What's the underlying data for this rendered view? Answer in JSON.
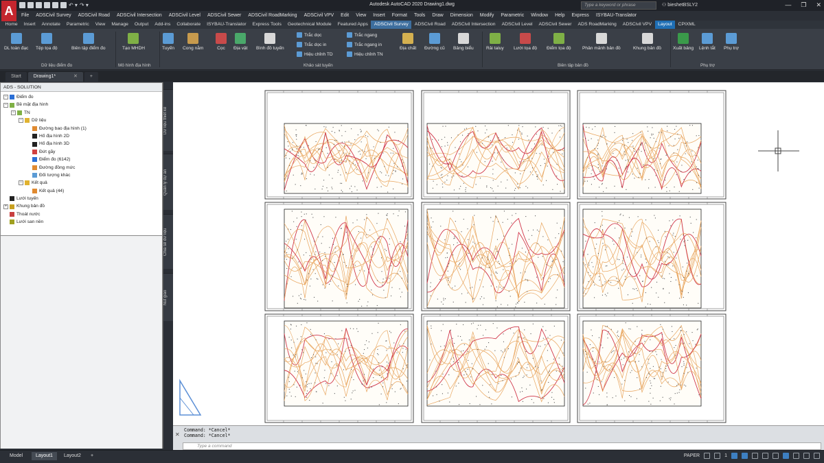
{
  "app": {
    "title": "Autodesk AutoCAD 2020    Drawing1.dwg",
    "logo": "A",
    "search_placeholder": "Type a keyword or phrase",
    "user": "bieshetBSLY2"
  },
  "menu": [
    "File",
    "ADSCivil Survey",
    "ADSCivil Road",
    "ADSCivil Intersection",
    "ADSCivil Level",
    "ADSCivil Sewer",
    "ADSCivil RoadMarking",
    "ADSCivil VPV",
    "Edit",
    "View",
    "Insert",
    "Format",
    "Tools",
    "Draw",
    "Dimension",
    "Modify",
    "Parametric",
    "Window",
    "Help",
    "Express",
    "ISYBAU-Translator"
  ],
  "ribbon_tabs": [
    "Home",
    "Insert",
    "Annotate",
    "Parametric",
    "View",
    "Manage",
    "Output",
    "Add-ins",
    "Collaborate",
    "ISYBAU-Translator",
    "Express Tools",
    "Geotechnical Module",
    "Featured Apps",
    "ADSCivil Survey",
    "ADSCivil Road",
    "ADSCivil Intersection",
    "ADSCivil Level",
    "ADSCivil Sewer",
    "ADS RoadMarking",
    "ADSCivil VPV",
    "Layout",
    "CPIXML"
  ],
  "ribbon": {
    "tools": [
      "DL toàn đạc",
      "Tệp tọa độ",
      "Biên tập điểm đo",
      "Tạo MHDH",
      "Tuyến",
      "Cong nằm",
      "Cọc",
      "Địa vật",
      "Bình đồ tuyến",
      "Địa chất",
      "Đường cũ",
      "Bảng biểu",
      "Rải taluy",
      "Lưới tọa độ",
      "Điểm tọa độ",
      "Phân mảnh bản đồ",
      "Khung bản đồ",
      "Xuất bảng",
      "Lệnh tắt",
      "Phụ trợ"
    ],
    "small": [
      "Trắc dọc",
      "Trắc dọc in",
      "Hiệu chỉnh TD",
      "Trắc ngang",
      "Trắc ngang in",
      "Hiệu chỉnh TN"
    ],
    "groups": [
      "Dữ liệu điểm đo",
      "Mô hình địa hình",
      "Khảo sát tuyến",
      "Biên tập bản đồ",
      "Phụ trợ"
    ]
  },
  "file_tabs": {
    "start": "Start",
    "drawing": "Drawing1*",
    "close": "✕",
    "add": "+"
  },
  "palette": {
    "title": "ADS - SOLUTION",
    "tree": [
      {
        "label": "Điểm đo",
        "indent": 0,
        "toggle": "−",
        "color": "#2b6fd6"
      },
      {
        "label": "Bề mặt địa hình",
        "indent": 0,
        "toggle": "−",
        "color": "#7fb046"
      },
      {
        "label": "TN",
        "indent": 1,
        "toggle": "−",
        "color": "#7fb046"
      },
      {
        "label": "Dữ liệu",
        "indent": 2,
        "toggle": "−",
        "color": "#e0b230"
      },
      {
        "label": "Đường bao địa hình (1)",
        "indent": 3,
        "toggle": "",
        "color": "#e08a30"
      },
      {
        "label": "Hố địa hình 2D",
        "indent": 3,
        "toggle": "",
        "color": "#222222"
      },
      {
        "label": "Hố địa hình 3D",
        "indent": 3,
        "toggle": "",
        "color": "#222222"
      },
      {
        "label": "Đứt gãy",
        "indent": 3,
        "toggle": "",
        "color": "#d04040"
      },
      {
        "label": "Điểm đo (6142)",
        "indent": 3,
        "toggle": "",
        "color": "#2b6fd6"
      },
      {
        "label": "Đường đồng mức",
        "indent": 3,
        "toggle": "",
        "color": "#e08a30"
      },
      {
        "label": "Đối tượng khác",
        "indent": 3,
        "toggle": "",
        "color": "#5b9bd5"
      },
      {
        "label": "Kết quả",
        "indent": 2,
        "toggle": "−",
        "color": "#e0b230"
      },
      {
        "label": "Kết quả (44)",
        "indent": 3,
        "toggle": "",
        "color": "#e08a30"
      },
      {
        "label": "Lưới tuyến",
        "indent": 0,
        "toggle": "",
        "color": "#222222"
      },
      {
        "label": "Khung bản đồ",
        "indent": 0,
        "toggle": "+",
        "color": "#c8a020"
      },
      {
        "label": "Thoát nước",
        "indent": 0,
        "toggle": "",
        "color": "#c84040"
      },
      {
        "label": "Lưới san nền",
        "indent": 0,
        "toggle": "",
        "color": "#a0a020"
      }
    ]
  },
  "vertical_tabs": [
    "Dữ liệu thiết kế",
    "Quản lý dự án",
    "Chia sẻ dữ liệu",
    "Nút giao"
  ],
  "command": {
    "history": [
      "Command: *Cancel*",
      "Command: *Cancel*"
    ],
    "placeholder": "Type a command",
    "close": "✕"
  },
  "layout_tabs": [
    "Model",
    "Layout1",
    "Layout2",
    "+"
  ],
  "status": {
    "paper": "PAPER",
    "scale": "1"
  },
  "colors": {
    "accent": "#3d6e9e",
    "contour_orange": "#e8a45c",
    "contour_red": "#d0364a",
    "point_gray": "#555555"
  },
  "sheets": {
    "rows": 3,
    "cols": 3
  }
}
